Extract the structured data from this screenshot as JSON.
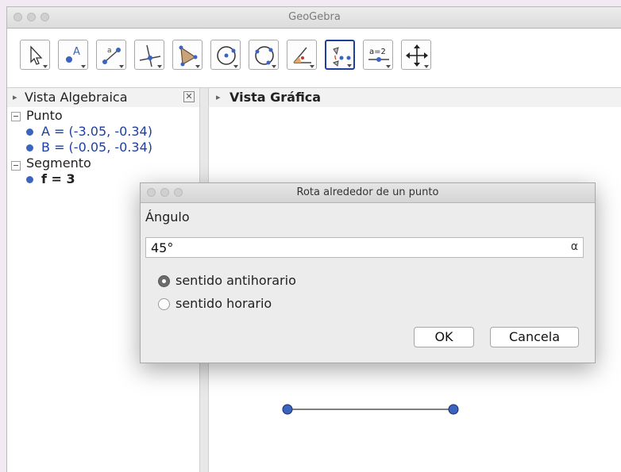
{
  "window": {
    "title": "GeoGebra"
  },
  "toolbar": {
    "tools": [
      {
        "name": "move-tool-icon"
      },
      {
        "name": "point-tool-icon",
        "label": "A"
      },
      {
        "name": "segment-tool-icon",
        "label": "a"
      },
      {
        "name": "perpendicular-line-tool-icon"
      },
      {
        "name": "polygon-tool-icon"
      },
      {
        "name": "circle-center-point-tool-icon"
      },
      {
        "name": "circle-three-points-tool-icon"
      },
      {
        "name": "angle-tool-icon"
      },
      {
        "name": "rotate-around-point-tool-icon"
      },
      {
        "name": "slider-tool-icon",
        "label": "a=2"
      },
      {
        "name": "move-graphics-view-tool-icon"
      }
    ],
    "active_index": 8
  },
  "algebra_view": {
    "title": "Vista Algebraica",
    "groups": [
      {
        "label": "Punto",
        "items": [
          "A = (-3.05, -0.34)",
          "B = (-0.05, -0.34)"
        ]
      },
      {
        "label": "Segmento",
        "items": [
          "f = 3"
        ]
      }
    ]
  },
  "graphics_view": {
    "title": "Vista Gráfica"
  },
  "dialog": {
    "title": "Rota alrededor de un punto",
    "angle_label": "Ángulo",
    "angle_value": "45°",
    "alpha_button": "α",
    "radio_options": [
      "sentido antihorario",
      "sentido horario"
    ],
    "selected_option": 0,
    "ok_label": "OK",
    "cancel_label": "Cancela"
  },
  "colors": {
    "accent": "#1f3f9a",
    "point": "#3a64c0",
    "object_text": "#1e3fa0"
  }
}
